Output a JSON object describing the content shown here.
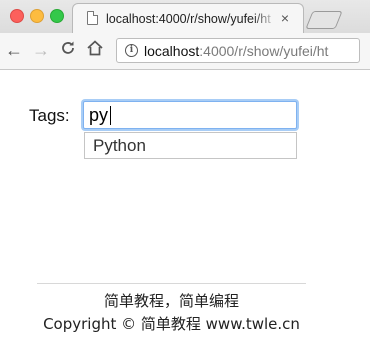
{
  "browser": {
    "tab_title": "localhost:4000/r/show/yufei/ht",
    "tab_close": "×",
    "address": {
      "host": "localhost",
      "path": ":4000/r/show/yufei/ht"
    },
    "icons": {
      "back": "back-arrow-icon",
      "forward": "forward-arrow-icon",
      "reload": "reload-icon",
      "home": "home-icon",
      "info": "info-icon"
    }
  },
  "form": {
    "label": "Tags:",
    "input_value": "py",
    "suggestions": [
      "Python"
    ]
  },
  "footer": {
    "line1": "简单教程，简单编程",
    "line2": "Copyright © 简单教程 www.twle.cn"
  },
  "colors": {
    "focus_ring": "#7fb2f0",
    "traffic_red": "#fc605c",
    "traffic_yellow": "#fdbc40",
    "traffic_green": "#34c84a"
  }
}
